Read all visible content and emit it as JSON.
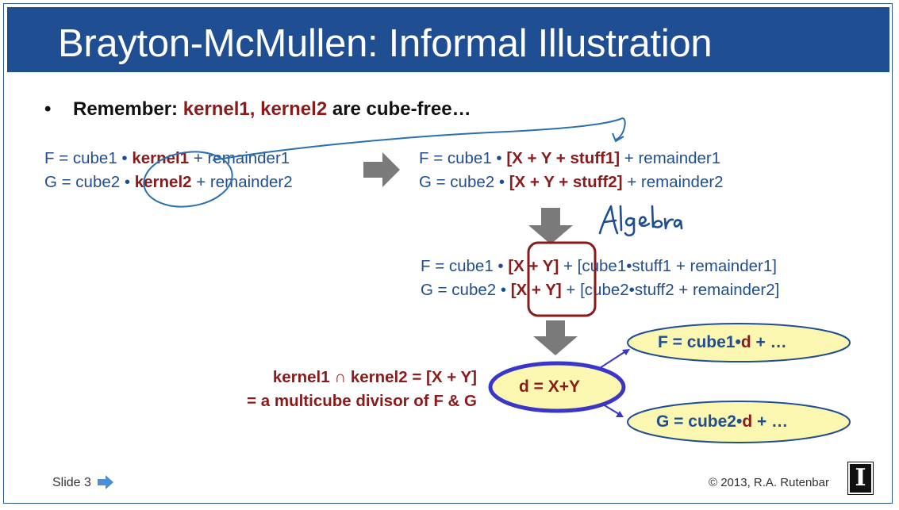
{
  "slide": {
    "title": "Brayton-McMullen: Informal Illustration",
    "bullet": {
      "marker": "•",
      "prefix": "Remember:",
      "emphasis": "kernel1, kernel2",
      "suffix": "are cube-free…"
    },
    "left_eqs": {
      "f_pre": "F = cube1 • ",
      "f_kernel": "kernel1",
      "f_post": " + remainder1",
      "g_pre": "G = cube2 • ",
      "g_kernel": "kernel2",
      "g_post": " + remainder2"
    },
    "right_eqs": {
      "f_pre": "F  = cube1 • ",
      "f_bracket": "[X + Y + stuff1]",
      "f_post": "  + remainder1",
      "g_pre": "G = cube2 • ",
      "g_bracket": "[X + Y + stuff2]",
      "g_post": "  + remainder2"
    },
    "handwritten": "Algebra",
    "mid_eqs": {
      "f_pre": "F  = cube1 • ",
      "f_bracket": "[X + Y]",
      "f_post": " +  [cube1•stuff1  + remainder1]",
      "g_pre": "G = cube2 • ",
      "g_bracket": "[X + Y]",
      "g_post": " +  [cube2•stuff2  + remainder2]"
    },
    "kernel_note": {
      "line1": "kernel1 ∩ kernel2 = [X + Y]",
      "line2": "= a multicube divisor of F & G"
    },
    "divisor": "d = X+Y",
    "f_result": {
      "pre": "F  = cube1•",
      "d": "d",
      "post": " + …"
    },
    "g_result": {
      "pre": "G = cube2•",
      "d": "d",
      "post": " + …"
    },
    "footer": {
      "slide_label": "Slide 3",
      "copyright": "© 2013, R.A. Rutenbar",
      "logo_letter": "I"
    }
  },
  "colors": {
    "title_bar": "#1f4e93",
    "text_blue": "#1f4e93",
    "emphasis_red": "#8b1a1a",
    "ellipse_fill": "#fbf7b0",
    "arrow_gray": "#7a7a7a"
  }
}
